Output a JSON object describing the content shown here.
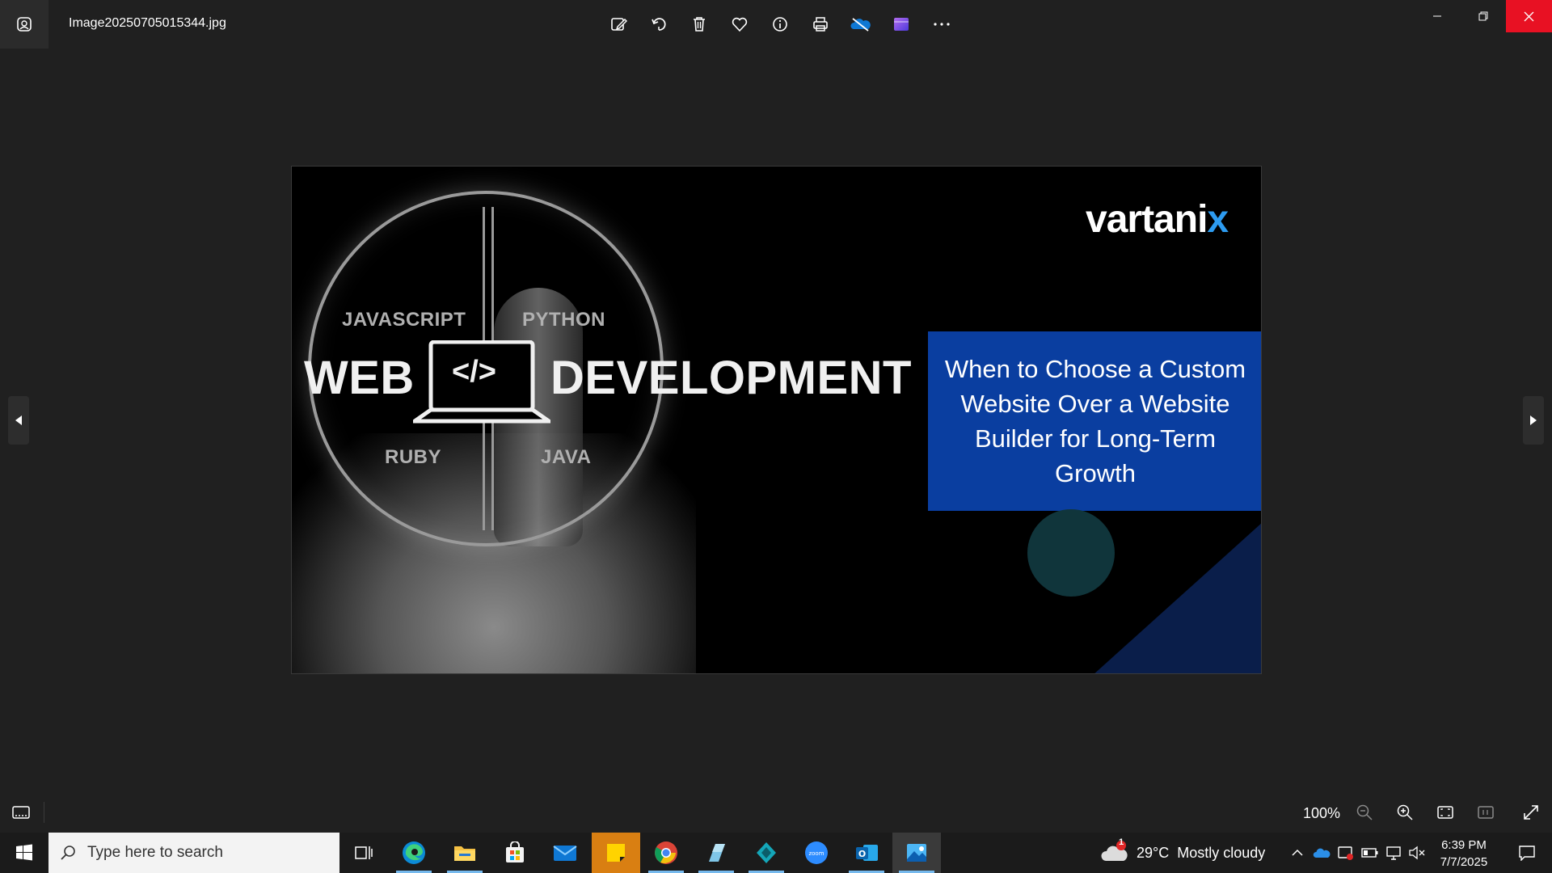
{
  "window": {
    "filename": "Image20250705015344.jpg"
  },
  "toolbar": {
    "items": [
      {
        "name": "edit-image-button",
        "icon": "edit-image-icon"
      },
      {
        "name": "rotate-button",
        "icon": "rotate-icon"
      },
      {
        "name": "delete-button",
        "icon": "trash-icon"
      },
      {
        "name": "favorite-button",
        "icon": "heart-icon"
      },
      {
        "name": "info-button",
        "icon": "info-icon"
      },
      {
        "name": "print-button",
        "icon": "printer-icon"
      },
      {
        "name": "onedrive-button",
        "icon": "onedrive-icon"
      },
      {
        "name": "video-editor-button",
        "icon": "clapper-icon"
      },
      {
        "name": "more-button",
        "icon": "ellipsis-icon"
      }
    ]
  },
  "image": {
    "languages": {
      "top_left": "JAVASCRIPT",
      "top_right": "PYTHON",
      "bottom_left": "RUBY",
      "bottom_right": "JAVA"
    },
    "headline_left": "WEB",
    "headline_right": "DEVELOPMENT",
    "laptop_code": "</>",
    "logo_main": "vartani",
    "logo_accent": "x",
    "callout": "When to Choose a Custom Website Over a Website Builder for Long-Term Growth"
  },
  "bottombar": {
    "zoom": "100%"
  },
  "taskbar": {
    "search_placeholder": "Type here to search",
    "weather": "29°C  Mostly cloudy",
    "weather_badge": "1",
    "time": "6:39 PM",
    "date": "7/7/2025"
  },
  "colors": {
    "close_red": "#e81123",
    "callout_blue": "#0a3ea0",
    "taskbar_accent": "#76b9ed"
  }
}
